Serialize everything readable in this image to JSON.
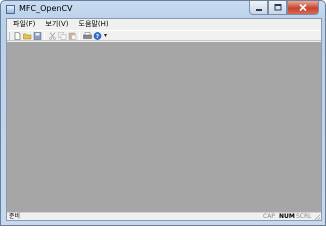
{
  "window": {
    "title": "MFC_OpenCV"
  },
  "menu": [
    {
      "label": "파일(F)"
    },
    {
      "label": "보기(V)"
    },
    {
      "label": "도움말(H)"
    }
  ],
  "toolbar": {
    "buttons": [
      {
        "name": "new-file-icon"
      },
      {
        "name": "open-folder-icon"
      },
      {
        "name": "save-icon"
      },
      {
        "name": "cut-icon"
      },
      {
        "name": "copy-icon"
      },
      {
        "name": "paste-icon"
      },
      {
        "name": "print-icon"
      },
      {
        "name": "about-icon"
      }
    ],
    "overflow_glyph": "▾"
  },
  "status": {
    "text": "준비",
    "indicators": [
      {
        "label": "CAP",
        "active": false
      },
      {
        "label": "NUM",
        "active": true
      },
      {
        "label": "SCRL",
        "active": false
      }
    ]
  },
  "colors": {
    "view_background": "#a6a6a6",
    "frame": "#c7d9ee",
    "chrome": "#f0f0f0"
  }
}
